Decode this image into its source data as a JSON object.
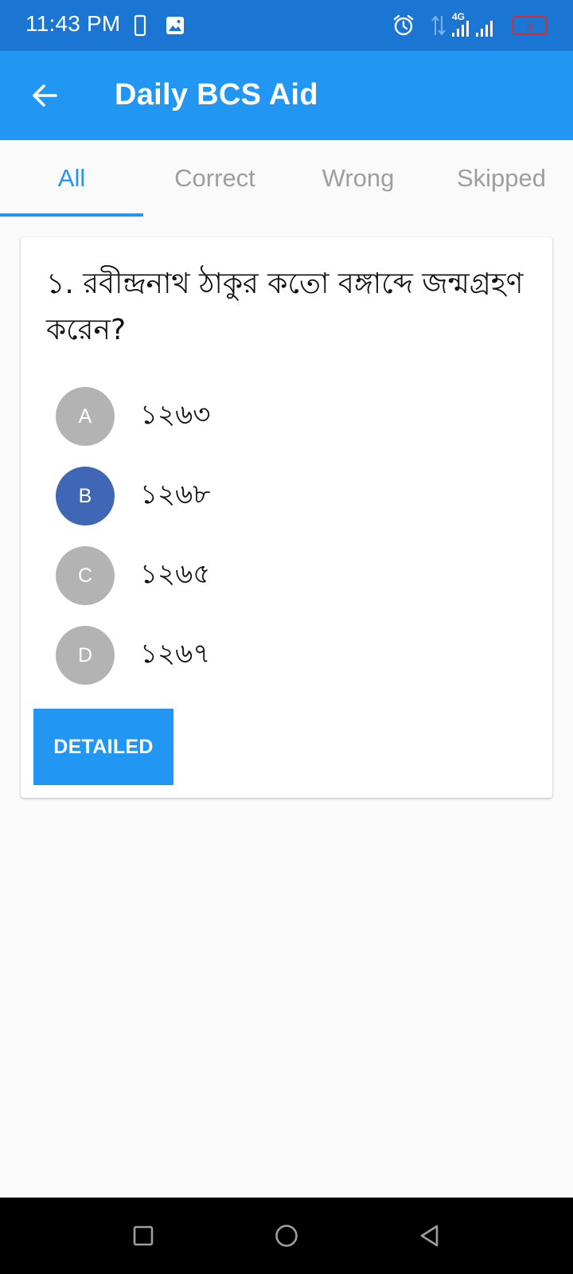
{
  "status_bar": {
    "time": "11:43 PM",
    "network": "4G",
    "battery": "5",
    "icons": [
      "phone-icon",
      "image-icon",
      "alarm-icon",
      "data-arrows-icon",
      "signal-icon",
      "battery-icon"
    ]
  },
  "app_bar": {
    "title": "Daily BCS Aid",
    "back_icon": "arrow-left-icon"
  },
  "tabs": [
    {
      "label": "All",
      "active": true
    },
    {
      "label": "Correct",
      "active": false
    },
    {
      "label": "Wrong",
      "active": false
    },
    {
      "label": "Skipped",
      "active": false
    }
  ],
  "question": {
    "text": "১. রবীন্দ্রনাথ ঠাকুর কতো বঙ্গাব্দে জন্মগ্রহণ করেন?",
    "options": [
      {
        "letter": "A",
        "text": "১২৬৩",
        "selected": false
      },
      {
        "letter": "B",
        "text": "১২৬৮",
        "selected": true
      },
      {
        "letter": "C",
        "text": "১২৬৫",
        "selected": false
      },
      {
        "letter": "D",
        "text": "১২৬৭",
        "selected": false
      }
    ],
    "detailed_button": "DETAILED"
  },
  "nav_bar": {
    "icons": [
      "recents-icon",
      "home-icon",
      "back-icon"
    ]
  },
  "colors": {
    "status_bar": "#1b76d3",
    "app_bar": "#2196f3",
    "accent": "#2196f3",
    "selected_option": "#3f67b5",
    "unselected_option": "#b3b3b3"
  }
}
